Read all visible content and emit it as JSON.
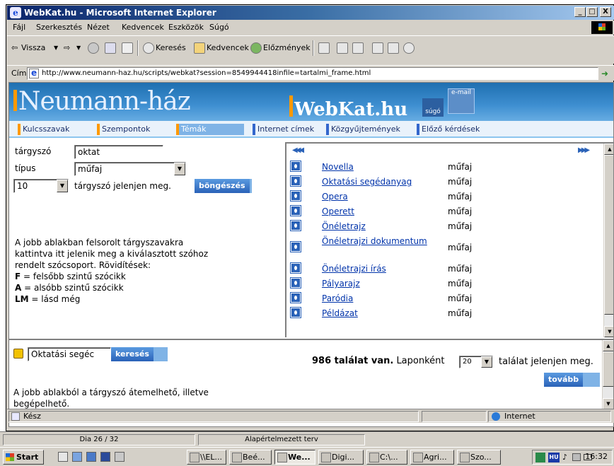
{
  "window": {
    "title": "WebKat.hu - Microsoft Internet Explorer",
    "min": "_",
    "max": "□",
    "close": "X"
  },
  "menu": [
    "Fájl",
    "Szerkesztés",
    "Nézet",
    "Kedvencek",
    "Eszközök",
    "Súgó"
  ],
  "toolbar": {
    "back": "Vissza",
    "search": "Keresés",
    "favorites": "Kedvencek",
    "history": "Előzmények"
  },
  "address": {
    "label": "Cím",
    "url": "http://www.neumann-haz.hu/scripts/webkat?session=8549944418infile=tartalmi_frame.html",
    "go": "Ugrás"
  },
  "header": {
    "logo_left": "Neumann-ház",
    "logo_right": "WebKat.hu",
    "help": "súgó",
    "email": "e-mail",
    "nav": [
      {
        "label": "Kulcsszavak"
      },
      {
        "label": "Szempontok"
      },
      {
        "label": "Témák"
      },
      {
        "label": "Internet címek"
      },
      {
        "label": "Közgyűjtemények"
      },
      {
        "label": "Előző kérdések"
      }
    ]
  },
  "form": {
    "term_label": "tárgyszó",
    "term_value": "oktat",
    "type_label": "típus",
    "type_value": "műfaj",
    "count_value": "10",
    "count_suffix": "tárgyszó jelenjen meg.",
    "browse_button": "böngészés"
  },
  "help": {
    "line1": "A jobb ablakban felsorolt tárgyszavakra",
    "line2": "kattintva itt jelenik meg a kiválasztott szóhoz",
    "line3": "rendelt szócsoport. Rövidítések:",
    "f_key": "F",
    "f_text": " = felsőbb szintű szócikk",
    "a_key": "A",
    "a_text": " = alsóbb szintű szócikk",
    "lm_key": "LM",
    "lm_text": " = lásd még"
  },
  "results_list": [
    {
      "term": "Novella",
      "type": "műfaj"
    },
    {
      "term": "Oktatási segédanyag",
      "type": "műfaj"
    },
    {
      "term": "Opera",
      "type": "műfaj"
    },
    {
      "term": "Operett",
      "type": "műfaj"
    },
    {
      "term": "Önéletrajz",
      "type": "műfaj"
    },
    {
      "term": "Önéletrajzi dokumentum",
      "type": "műfaj"
    },
    {
      "term": "Önéletrajzi írás",
      "type": "műfaj"
    },
    {
      "term": "Pályarajz",
      "type": "műfaj"
    },
    {
      "term": "Paródia",
      "type": "műfaj"
    },
    {
      "term": "Példázat",
      "type": "műfaj"
    }
  ],
  "bottom": {
    "search_value": "Oktatási segéc",
    "search_button": "keresés",
    "hits_bold": "986 találat van.",
    "per_page_label": "Laponként",
    "per_page_value": "20",
    "per_page_suffix": "találat jelenjen meg.",
    "next_button": "tovább",
    "note_line1": "A jobb ablakból a tárgyszó átemelhető, illetve",
    "note_line2": "begépelhető."
  },
  "status": {
    "text": "Kész",
    "zone": "Internet"
  },
  "app_band": {
    "slide": "Dia 26 / 32",
    "design": "Alapértelmezett terv"
  },
  "taskbar": {
    "start": "Start",
    "tasks": [
      "\\\\EL...",
      "Beé...",
      "We...",
      "Digi...",
      "C:\\...",
      "Agri...",
      "Szo..."
    ],
    "lang": "HU",
    "clock": "16:32"
  }
}
